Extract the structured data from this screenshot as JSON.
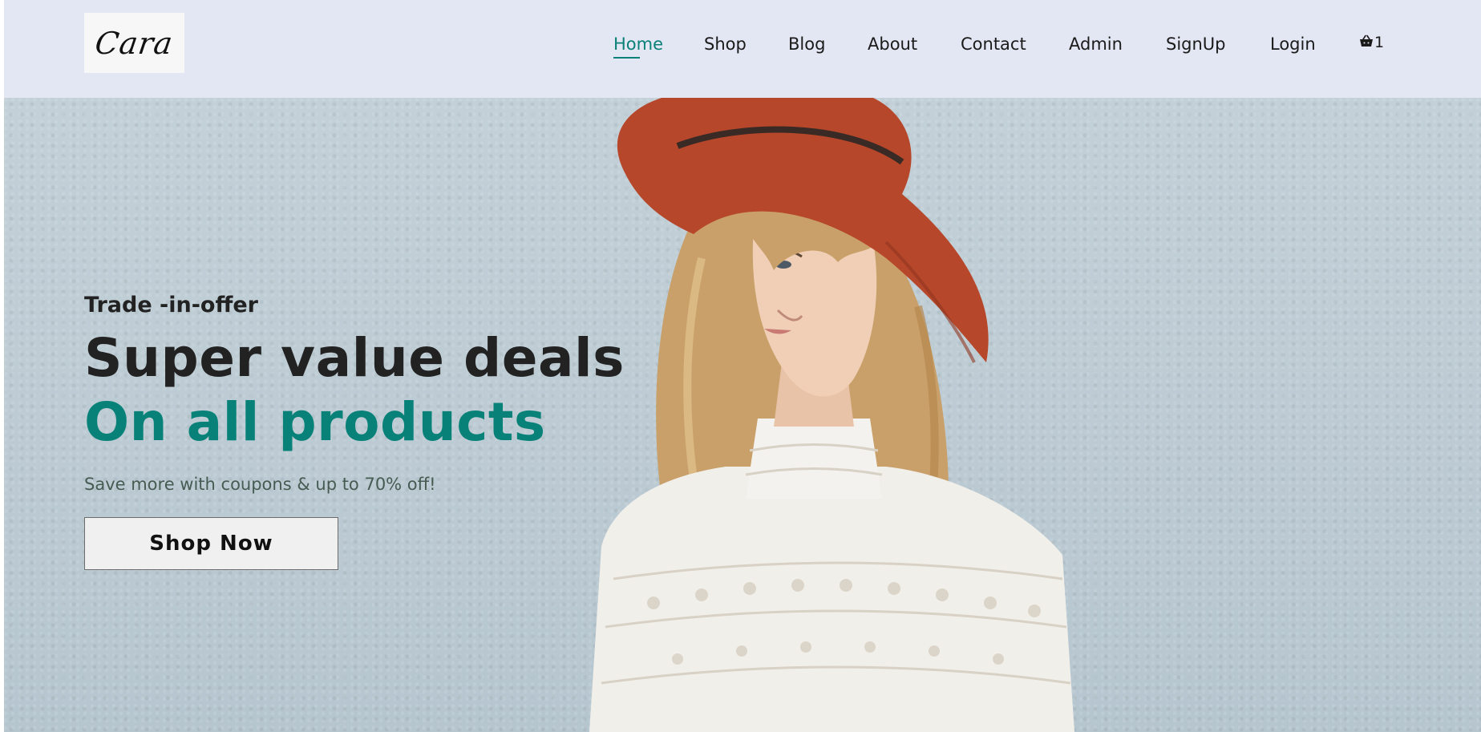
{
  "brand": {
    "logo_text": "Cara"
  },
  "nav": {
    "items": [
      {
        "label": "Home",
        "active": true
      },
      {
        "label": "Shop"
      },
      {
        "label": "Blog"
      },
      {
        "label": "About"
      },
      {
        "label": "Contact"
      },
      {
        "label": "Admin"
      },
      {
        "label": "SignUp"
      },
      {
        "label": "Login"
      }
    ],
    "cart": {
      "icon": "basket-icon",
      "count": "1"
    }
  },
  "hero": {
    "eyebrow": "Trade -in-offer",
    "headline": "Super value deals",
    "subheadline": "On all products",
    "tagline": "Save more with coupons & up to 70% off!",
    "cta_label": "Shop Now",
    "image": "woman-in-red-hat-and-white-lace-dress"
  },
  "colors": {
    "accent": "#088178",
    "header_bg": "#e3e6f3",
    "hero_bg": "#bccbd4",
    "text_dark": "#222222"
  }
}
